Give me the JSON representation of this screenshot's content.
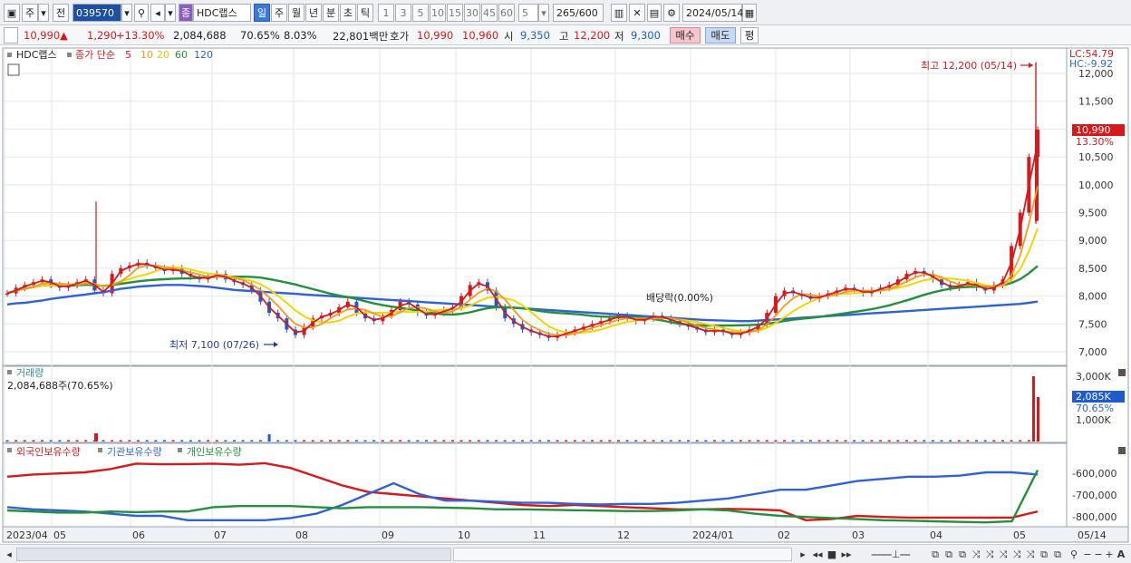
{
  "toolbar": {
    "period_label": "주",
    "prev_label": "전",
    "stock_code": "039570",
    "stock_name": "HDC랩스",
    "badge": "종",
    "timeframes": [
      "일",
      "주",
      "월",
      "년",
      "분",
      "초",
      "틱"
    ],
    "intervals": [
      "1",
      "3",
      "5",
      "10",
      "15",
      "30",
      "45",
      "60"
    ],
    "interval_value": "5",
    "count": "265",
    "count_total": "/600",
    "date": "2024/05/14"
  },
  "quote": {
    "price": "10,990",
    "arrow": "▲",
    "change": "1,290",
    "change_pct": "+13.30%",
    "volume": "2,084,688",
    "vol_ratio": "70.65%",
    "turnover": "8.03%",
    "amount": "22,801백만",
    "hoga_label": "호가",
    "ask": "10,990",
    "bid": "10,960",
    "open_label": "시",
    "open": "9,350",
    "high_label": "고",
    "high": "12,200",
    "low_label": "저",
    "low": "9,300",
    "buy_label": "매수",
    "sell_label": "매도",
    "avg_label": "평"
  },
  "price_panel": {
    "legend_name": "HDC랩스",
    "legend_ma": "종가 단순",
    "ma_periods": [
      "5",
      "10",
      "20",
      "60",
      "120"
    ],
    "ma_colors": [
      "#d7191c",
      "#f29b1d",
      "#f2d600",
      "#23913a",
      "#2f62d6"
    ],
    "lc": "LC:54.79",
    "hc": "HC:-9.92",
    "high_annot": "최고 12,200 (05/14)",
    "low_annot": "최저 7,100 (07/26)",
    "dividend_annot": "배당락(0.00%)",
    "current_price": "10,990",
    "current_pct": "13.30%",
    "y_ticks": [
      "12,000",
      "11,500",
      "11,000",
      "10,500",
      "10,000",
      "9,500",
      "9,000",
      "8,500",
      "8,000",
      "7,500",
      "7,000"
    ]
  },
  "volume_panel": {
    "title": "거래량",
    "value": "2,084,688주(70.65%)",
    "y_ticks": [
      "3,000K",
      "2,000K",
      "1,000K"
    ],
    "current": "2,085K",
    "current_pct": "70.65%"
  },
  "holdings_panel": {
    "series_names": [
      "외국인보유수량",
      "기관보유수량",
      "개인보유수량"
    ],
    "series_colors": [
      "#d7191c",
      "#2f62d6",
      "#23913a"
    ],
    "y_ticks": [
      "-600,000",
      "-700,000",
      "-800,000"
    ]
  },
  "x_axis": {
    "labels": [
      "2023/04",
      "05",
      "06",
      "07",
      "08",
      "09",
      "10",
      "11",
      "12",
      "2024/01",
      "02",
      "03",
      "04",
      "05",
      "05/14"
    ]
  },
  "chart_data": {
    "type": "line",
    "price_series": {
      "close": [
        8050,
        8150,
        8200,
        8250,
        8300,
        8200,
        8150,
        8200,
        8250,
        8300,
        8100,
        8050,
        8400,
        8500,
        8550,
        8600,
        8550,
        8500,
        8450,
        8500,
        8400,
        8350,
        8300,
        8350,
        8400,
        8300,
        8250,
        8200,
        8100,
        7900,
        7700,
        7600,
        7400,
        7300,
        7450,
        7600,
        7650,
        7700,
        7800,
        7900,
        7700,
        7600,
        7550,
        7650,
        7750,
        7900,
        7850,
        7700,
        7650,
        7700,
        7750,
        7800,
        8000,
        8200,
        8250,
        8100,
        7800,
        7600,
        7500,
        7400,
        7350,
        7300,
        7250,
        7300,
        7350,
        7400,
        7450,
        7500,
        7550,
        7600,
        7650,
        7600,
        7550,
        7600,
        7650,
        7600,
        7550,
        7500,
        7450,
        7400,
        7350,
        7400,
        7350,
        7300,
        7350,
        7400,
        7500,
        7700,
        8000,
        8100,
        8050,
        8000,
        7950,
        8000,
        8050,
        8100,
        8150,
        8100,
        8050,
        8100,
        8150,
        8200,
        8300,
        8400,
        8450,
        8400,
        8300,
        8200,
        8150,
        8200,
        8250,
        8150,
        8100,
        8200,
        8300,
        8900,
        9500,
        10500,
        10990
      ],
      "ma120": [
        7850,
        7870,
        7880,
        7900,
        7920,
        7950,
        7970,
        7990,
        8010,
        8030,
        8050,
        8070,
        8100,
        8130,
        8150,
        8170,
        8180,
        8190,
        8200,
        8200,
        8200,
        8190,
        8180,
        8170,
        8150,
        8130,
        8110,
        8100,
        8090,
        8080,
        8070,
        8060,
        8050,
        8040,
        8030,
        8020,
        8010,
        8000,
        7990,
        7980,
        7970,
        7960,
        7950,
        7940,
        7930,
        7920,
        7910,
        7900,
        7890,
        7880,
        7870,
        7860,
        7850,
        7840,
        7830,
        7820,
        7810,
        7800,
        7790,
        7780,
        7770,
        7760,
        7750,
        7740,
        7730,
        7720,
        7710,
        7700,
        7690,
        7680,
        7670,
        7660,
        7650,
        7640,
        7630,
        7620,
        7610,
        7600,
        7590,
        7580,
        7570,
        7565,
        7560,
        7555,
        7550,
        7550,
        7560,
        7570,
        7580,
        7590,
        7600,
        7610,
        7620,
        7630,
        7640,
        7650,
        7660,
        7670,
        7680,
        7690,
        7700,
        7710,
        7720,
        7730,
        7740,
        7750,
        7760,
        7770,
        7780,
        7790,
        7800,
        7810,
        7820,
        7830,
        7840,
        7850,
        7860,
        7880,
        7900
      ]
    },
    "volume_peak": "3,000K",
    "holdings": {
      "foreign_trend": "high mid-2023, declining to ~-800,000, flat into 2024/05",
      "institution_trend": "around -800,000, rising to ~-600,000 by 2024/05",
      "individual_trend": "around -780,000, dropping to -830,000 then spiking up at 05/14"
    }
  }
}
